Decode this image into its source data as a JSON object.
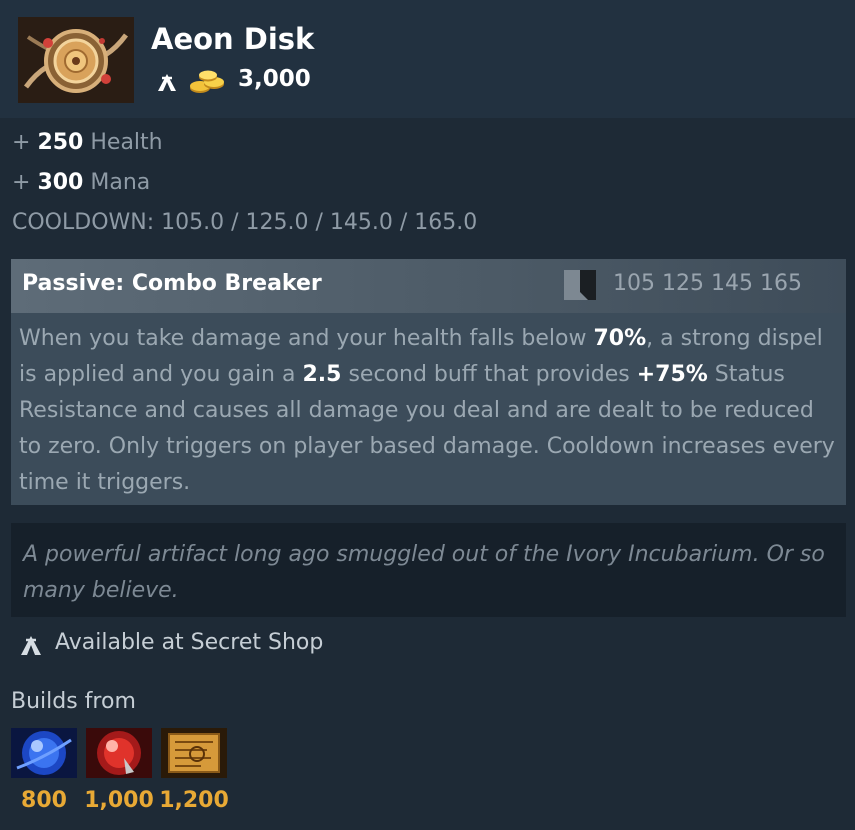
{
  "item": {
    "name": "Aeon Disk",
    "icon": "aeon-disk-icon",
    "cost": "3,000"
  },
  "attributes": [
    {
      "prefix": "+",
      "value": "250",
      "label": "Health"
    },
    {
      "prefix": "+",
      "value": "300",
      "label": "Mana"
    }
  ],
  "cooldown_line": "COOLDOWN: 105.0 / 125.0 / 145.0 / 165.0",
  "ability": {
    "title": "Passive: Combo Breaker",
    "cooldowns": "105 125 145 165",
    "desc": {
      "t1": "When you take damage and your health falls below ",
      "v1": "70%",
      "t2": ", a strong dispel is applied and you gain a ",
      "v2": "2.5",
      "t3": " second buff that provides ",
      "v3": "+75%",
      "t4": " Status Resistance and causes all damage you deal and are dealt to be reduced to zero. Only triggers on player based damage. Cooldown increases every time it triggers."
    }
  },
  "lore": "A powerful artifact long ago smuggled out of the Ivory Incubarium. Or so many believe.",
  "shop": "Available at Secret Shop",
  "builds_label": "Builds from",
  "components": [
    {
      "icon": "blue-orb-icon",
      "cost": "800"
    },
    {
      "icon": "red-orb-icon",
      "cost": "1,000"
    },
    {
      "icon": "recipe-scroll-icon",
      "cost": "1,200"
    }
  ],
  "colors": {
    "background": "#1e2a36",
    "header": "#223140",
    "ability_panel": "#3c4c5a",
    "lore_panel": "#16202a",
    "gold": "#e8a935"
  }
}
